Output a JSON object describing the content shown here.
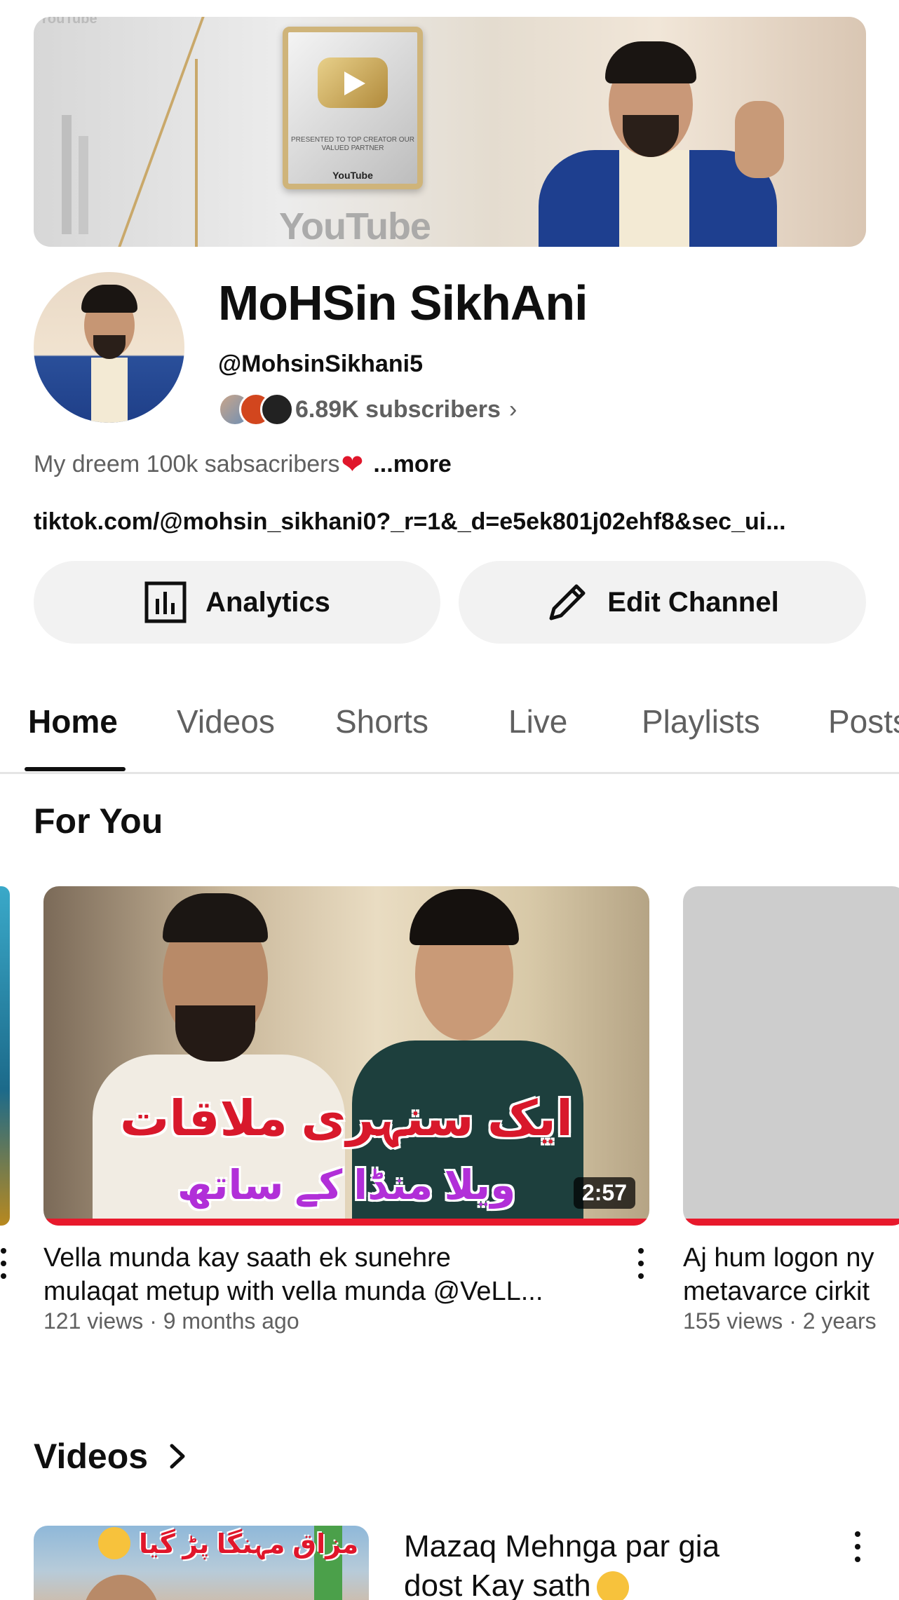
{
  "banner": {
    "youtube_small": "YouTube",
    "plaque_text": "PRESENTED TO TOP CREATOR OUR VALUED PARTNER",
    "plaque_brand": "YouTube",
    "youtube_word": "YouTube"
  },
  "channel": {
    "name": "MoHSin SikhAni",
    "handle": "@MohsinSikhani5",
    "subscribers": "6.89K subscribers",
    "description": "My dreem 100k sabsacribers",
    "more": "...more",
    "link": "tiktok.com/@mohsin_sikhani0?_r=1&_d=e5ek801j02ehf8&sec_ui..."
  },
  "buttons": {
    "analytics": "Analytics",
    "edit_channel": "Edit Channel"
  },
  "tabs": [
    {
      "label": "Home",
      "active": true
    },
    {
      "label": "Videos"
    },
    {
      "label": "Shorts"
    },
    {
      "label": "Live"
    },
    {
      "label": "Playlists"
    },
    {
      "label": "Posts"
    }
  ],
  "for_you": {
    "title": "For You",
    "videos": [
      {
        "title_line1": "Vella munda kay saath ek sunehre",
        "title_line2": "mulaqat metup with vella munda @VeLL...",
        "meta": "121 views · 9 months ago",
        "duration": "2:57",
        "urdu_line1": "ایک سنہری ملاقات",
        "urdu_line2": "ویلا منڈا کے ساتھ",
        "progress": 1.0
      },
      {
        "title_line1": "Aj hum logon ny",
        "title_line2": "metavarce  cirkit",
        "meta": "155 views · 2 years",
        "progress": 1.0
      }
    ]
  },
  "videos_section": {
    "title": "Videos",
    "first_video": {
      "title_line1": "Mazaq Mehnga par gia",
      "title_line2": "dost Kay sath",
      "thumb_urdu": "مزاق مہنگا پڑ گیا"
    }
  },
  "colors": {
    "accent_red": "#e8192c",
    "muted_text": "#606060",
    "button_bg": "#f2f2f2"
  }
}
